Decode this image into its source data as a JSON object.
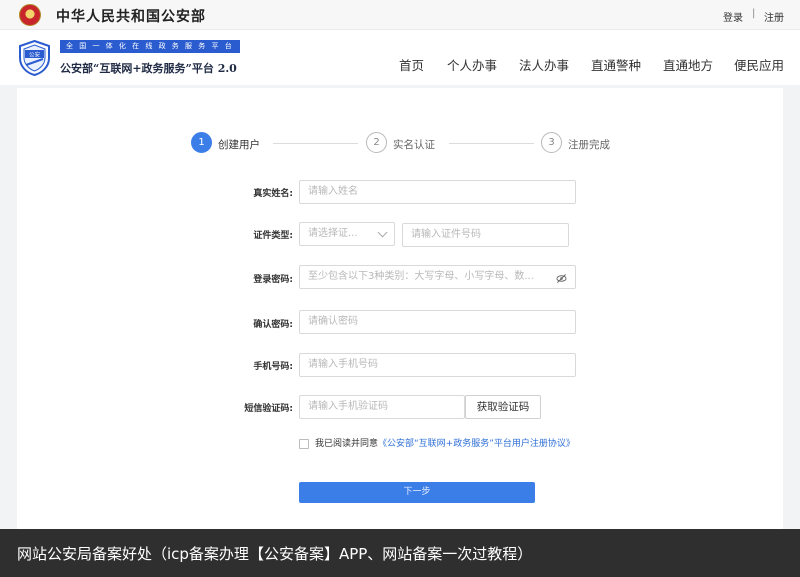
{
  "topbar": {
    "ministry": "中华人民共和国公安部",
    "login": "登录",
    "separator": "|",
    "register": "注册"
  },
  "header": {
    "logo_icon": "police-shield-icon",
    "logo_text": "公安",
    "tagline": "全 国 一 体 化 在 线 政 务 服 务 平 台",
    "platform": "公安部“互联网+政务服务”平台 2.0",
    "nav": [
      "首页",
      "个人办事",
      "法人办事",
      "直通警种",
      "直通地方",
      "便民应用"
    ]
  },
  "steps": [
    {
      "num": "1",
      "label": "创建用户",
      "state": "active"
    },
    {
      "num": "2",
      "label": "实名认证",
      "state": "inactive"
    },
    {
      "num": "3",
      "label": "注册完成",
      "state": "inactive"
    }
  ],
  "form": {
    "name_label": "真实姓名:",
    "name_placeholder": "请输入姓名",
    "idtype_label": "证件类型:",
    "idtype_placeholder": "请选择证...",
    "idnum_placeholder": "请输入证件号码",
    "password_label": "登录密码:",
    "password_placeholder": "至少包含以下3种类别：大写字母、小写字母、数...",
    "confirm_label": "确认密码:",
    "confirm_placeholder": "请确认密码",
    "phone_label": "手机号码:",
    "phone_placeholder": "请输入手机号码",
    "sms_label": "短信验证码:",
    "sms_placeholder": "请输入手机验证码",
    "get_code": "获取验证码",
    "agree_prefix": "我已阅读并同意",
    "agree_link": "《公安部“互联网+政务服务”平台用户注册协议》",
    "next": "下一步"
  },
  "caption": "网站公安局备案好处（icp备案办理【公安备案】APP、网站备案一次过教程）",
  "colors": {
    "accent": "#3c7ee8",
    "tagline_bg": "#2b5ccf",
    "link": "#2f6fd6",
    "caption_bg": "#2f2f2f"
  }
}
